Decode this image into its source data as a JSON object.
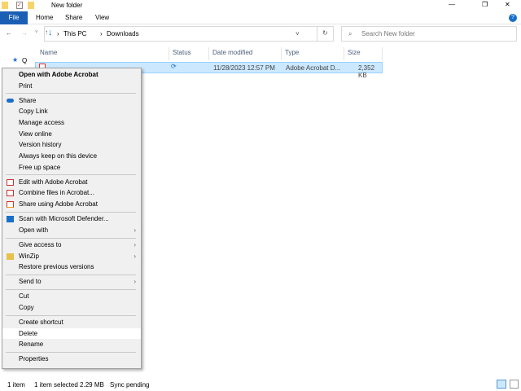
{
  "window": {
    "title": "New folder",
    "minimize": "—",
    "maximize": "❐",
    "close": "✕"
  },
  "ribbon": {
    "tabs": [
      "File",
      "Home",
      "Share",
      "View"
    ]
  },
  "address": {
    "path": [
      "This PC",
      "Downloads"
    ],
    "search_placeholder": "Search New folder"
  },
  "nav": {
    "quick_access_partial": "Q"
  },
  "columns": [
    "Name",
    "Status",
    "Date modified",
    "Type",
    "Size"
  ],
  "file": {
    "date": "11/28/2023 12:57 PM",
    "type": "Adobe Acrobat D...",
    "size": "2,352 KB",
    "status": "sync-pending-icon"
  },
  "menu": [
    {
      "label": "Open with Adobe Acrobat",
      "bold": true
    },
    {
      "label": "Print"
    },
    {
      "sep": true
    },
    {
      "label": "Share",
      "icon": "onedrive-cloud-icon"
    },
    {
      "label": "Copy Link"
    },
    {
      "label": "Manage access"
    },
    {
      "label": "View online"
    },
    {
      "label": "Version history"
    },
    {
      "label": "Always keep on this device"
    },
    {
      "label": "Free up space"
    },
    {
      "sep": true
    },
    {
      "label": "Edit with Adobe Acrobat",
      "icon": "acrobat-edit-icon"
    },
    {
      "label": "Combine files in Acrobat...",
      "icon": "acrobat-combine-icon"
    },
    {
      "label": "Share using Adobe Acrobat",
      "icon": "acrobat-share-icon"
    },
    {
      "sep": true
    },
    {
      "label": "Scan with Microsoft Defender...",
      "icon": "defender-shield-icon"
    },
    {
      "label": "Open with",
      "submenu": true
    },
    {
      "sep": true
    },
    {
      "label": "Give access to",
      "submenu": true
    },
    {
      "label": "WinZip",
      "icon": "winzip-icon",
      "submenu": true
    },
    {
      "label": "Restore previous versions"
    },
    {
      "sep": true
    },
    {
      "label": "Send to",
      "submenu": true
    },
    {
      "sep": true
    },
    {
      "label": "Cut"
    },
    {
      "label": "Copy"
    },
    {
      "sep": true
    },
    {
      "label": "Create shortcut"
    },
    {
      "label": "Delete",
      "highlighted": true
    },
    {
      "label": "Rename"
    },
    {
      "sep": true
    },
    {
      "label": "Properties"
    }
  ],
  "status": {
    "count": "1 item",
    "selected": "1 item selected  2.29 MB",
    "sync": "Sync pending"
  },
  "colors": {
    "accent": "#1a5fb4",
    "selection": "#cce8ff"
  }
}
